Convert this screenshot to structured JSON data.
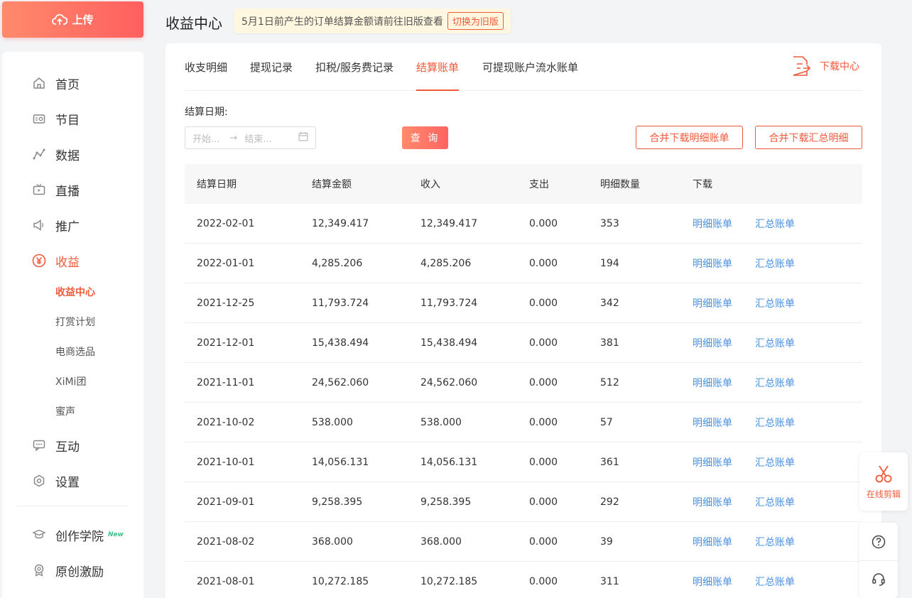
{
  "upload": {
    "label": "上传"
  },
  "sidebar": {
    "items": [
      {
        "label": "首页",
        "icon": "home-icon"
      },
      {
        "label": "节目",
        "icon": "radio-icon"
      },
      {
        "label": "数据",
        "icon": "chart-icon"
      },
      {
        "label": "直播",
        "icon": "tv-icon"
      },
      {
        "label": "推广",
        "icon": "speaker-icon"
      },
      {
        "label": "收益",
        "icon": "yen-icon"
      },
      {
        "label": "互动",
        "icon": "chat-icon"
      },
      {
        "label": "设置",
        "icon": "gear-icon"
      },
      {
        "label": "创作学院",
        "icon": "graduation-icon",
        "badge": "New"
      },
      {
        "label": "原创激励",
        "icon": "medal-icon"
      }
    ],
    "sub_items": [
      {
        "label": "收益中心"
      },
      {
        "label": "打赏计划"
      },
      {
        "label": "电商选品"
      },
      {
        "label": "XiMi团"
      },
      {
        "label": "蜜声"
      }
    ]
  },
  "header": {
    "title": "收益中心",
    "notice": "5月1日前产生的订单结算金额请前往旧版查看",
    "switch_label": "切换为旧版"
  },
  "tabs": [
    {
      "label": "收支明细"
    },
    {
      "label": "提现记录"
    },
    {
      "label": "扣税/服务费记录"
    },
    {
      "label": "结算账单"
    },
    {
      "label": "可提现账户流水账单"
    }
  ],
  "download_center": "下载中心",
  "filter": {
    "label": "结算日期:",
    "start_placeholder": "开始...",
    "end_placeholder": "结束...",
    "arrow": "→",
    "query_label": "查 询",
    "merge_detail_label": "合并下载明细账单",
    "merge_summary_label": "合并下载汇总明细"
  },
  "table": {
    "headers": [
      "结算日期",
      "结算金额",
      "收入",
      "支出",
      "明细数量",
      "下载"
    ],
    "detail_link": "明细账单",
    "summary_link": "汇总账单",
    "rows": [
      {
        "date": "2022-02-01",
        "amount": "12,349.417",
        "income": "12,349.417",
        "expense": "0.000",
        "count": "353"
      },
      {
        "date": "2022-01-01",
        "amount": "4,285.206",
        "income": "4,285.206",
        "expense": "0.000",
        "count": "194"
      },
      {
        "date": "2021-12-25",
        "amount": "11,793.724",
        "income": "11,793.724",
        "expense": "0.000",
        "count": "342"
      },
      {
        "date": "2021-12-01",
        "amount": "15,438.494",
        "income": "15,438.494",
        "expense": "0.000",
        "count": "381"
      },
      {
        "date": "2021-11-01",
        "amount": "24,562.060",
        "income": "24,562.060",
        "expense": "0.000",
        "count": "512"
      },
      {
        "date": "2021-10-02",
        "amount": "538.000",
        "income": "538.000",
        "expense": "0.000",
        "count": "57"
      },
      {
        "date": "2021-10-01",
        "amount": "14,056.131",
        "income": "14,056.131",
        "expense": "0.000",
        "count": "361"
      },
      {
        "date": "2021-09-01",
        "amount": "9,258.395",
        "income": "9,258.395",
        "expense": "0.000",
        "count": "292"
      },
      {
        "date": "2021-08-02",
        "amount": "368.000",
        "income": "368.000",
        "expense": "0.000",
        "count": "39"
      },
      {
        "date": "2021-08-01",
        "amount": "10,272.185",
        "income": "10,272.185",
        "expense": "0.000",
        "count": "311"
      }
    ]
  },
  "float": {
    "edit_label": "在线剪辑"
  },
  "colors": {
    "accent": "#f05a3a",
    "link": "#4a90e2"
  }
}
